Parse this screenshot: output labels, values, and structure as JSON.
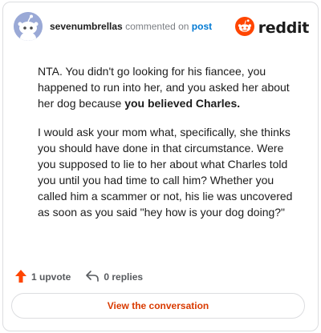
{
  "header": {
    "username": "sevenumbrellas",
    "action_text": "commented on",
    "post_link": "post",
    "brand_name": "reddit",
    "brand_color": "#ff4500",
    "avatar_icon": "snoo-avatar-icon",
    "avatar_color": "#9aa9d6"
  },
  "comment": {
    "p1_text": "NTA. You didn't go looking for his fiancee, you happened to run into her, and you asked her about her dog because ",
    "p1_bold": "you believed Charles.",
    "p2_text": "I would ask your mom what, specifically, she thinks you should have done in that circumstance. Were you supposed to lie to her about what Charles told you until you had time to call him? Whether you called him a scammer or not, his lie was uncovered as soon as you said \"hey how is your dog doing?\""
  },
  "actions": {
    "upvote_label": "1 upvote",
    "upvote_icon": "upvote-arrow-icon",
    "upvote_color": "#ff4500",
    "replies_label": "0 replies",
    "replies_icon": "reply-arrow-icon"
  },
  "footer": {
    "view_button_label": "View the conversation",
    "view_button_color": "#d93a00"
  }
}
